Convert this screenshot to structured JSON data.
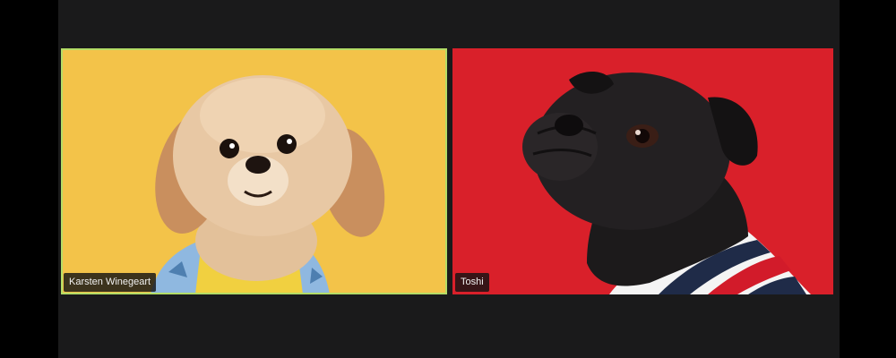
{
  "participants": [
    {
      "name": "Karsten Winegeart",
      "background": "#f3c349",
      "active_speaker": true,
      "highlight": "#b4dc66"
    },
    {
      "name": "Toshi",
      "background": "#d9202a",
      "active_speaker": false
    }
  ],
  "colors": {
    "window_bg": "#000000",
    "gallery_bg": "#1a1a1b",
    "name_tag_bg": "#141414"
  }
}
